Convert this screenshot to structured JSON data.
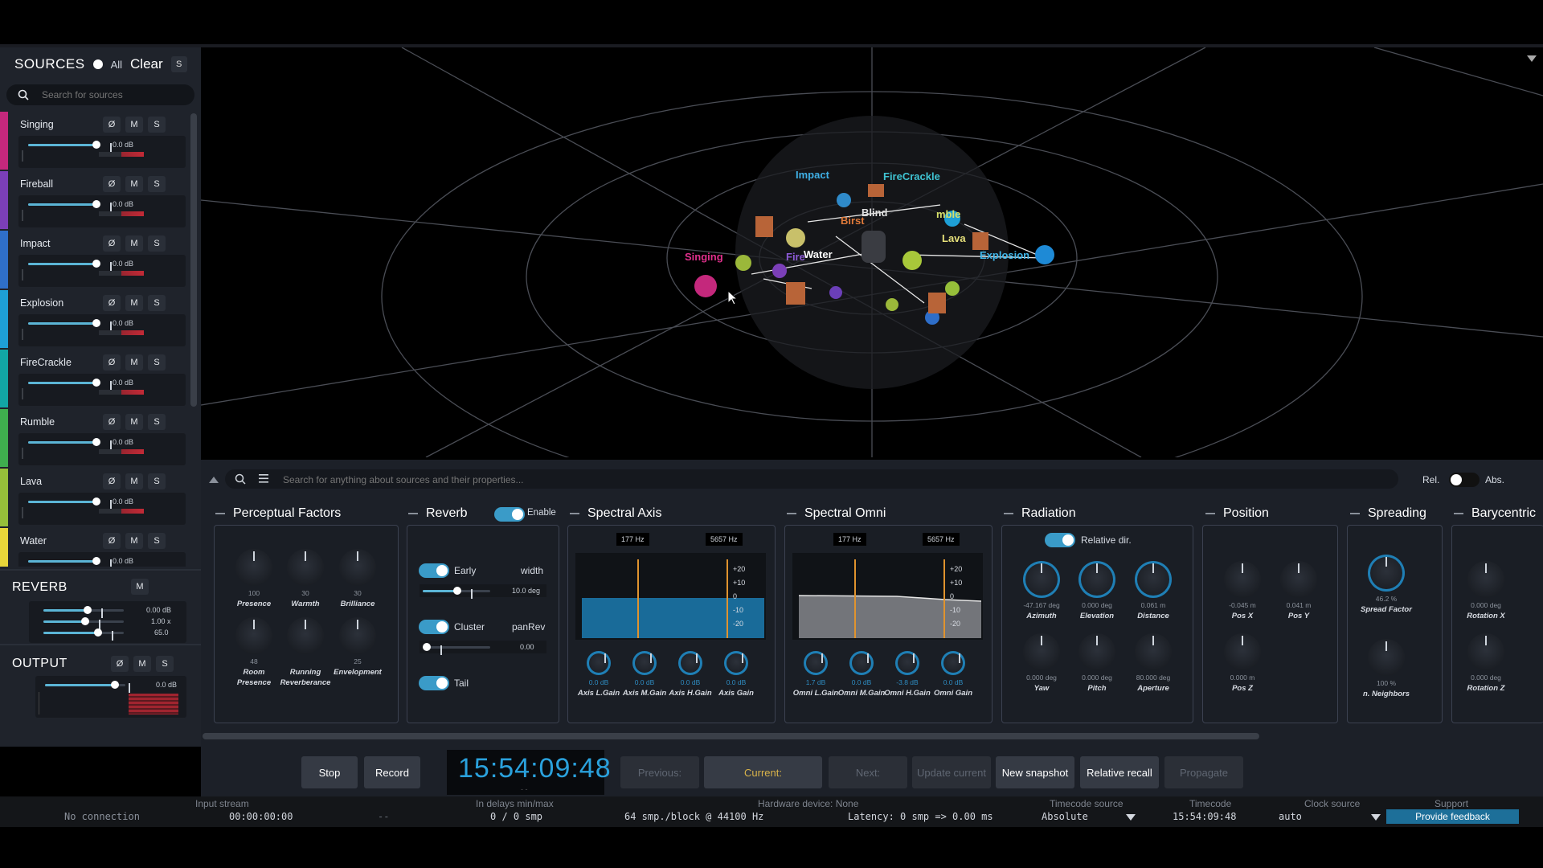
{
  "sidebar": {
    "title": "SOURCES",
    "all_label": "All",
    "clear_label": "Clear",
    "solo_label": "S",
    "search_placeholder": "Search for sources",
    "sources": [
      {
        "name": "Singing",
        "db": "0.0 dB",
        "color": "#c4287c"
      },
      {
        "name": "Fireball",
        "db": "0.0 dB",
        "color": "#7b3fb8"
      },
      {
        "name": "Impact",
        "db": "0.0 dB",
        "color": "#2f6fc9"
      },
      {
        "name": "Explosion",
        "db": "0.0 dB",
        "color": "#1e9fd6"
      },
      {
        "name": "FireCrackle",
        "db": "0.0 dB",
        "color": "#12a6a4"
      },
      {
        "name": "Rumble",
        "db": "0.0 dB",
        "color": "#3fae4e"
      },
      {
        "name": "Lava",
        "db": "0.0 dB",
        "color": "#96bf3a"
      },
      {
        "name": "Water",
        "db": "0.0 dB",
        "color": "#e8d63a"
      }
    ],
    "buttons": {
      "phase": "Ø",
      "mute": "M",
      "solo": "S"
    },
    "reverb": {
      "title": "REVERB",
      "mute": "M",
      "values": [
        "0.00 dB",
        "1.00 x",
        "65.0"
      ]
    },
    "output": {
      "title": "OUTPUT",
      "phase": "Ø",
      "mute": "M",
      "solo": "S",
      "db": "0.0 dB"
    }
  },
  "viewport": {
    "labels": [
      {
        "text": "Impact",
        "color": "#3fb0e6"
      },
      {
        "text": "FireCrackle",
        "color": "#3fc3d2"
      },
      {
        "text": "Singing",
        "color": "#e0308c"
      },
      {
        "text": "Water",
        "color": "#ffffff"
      },
      {
        "text": "Lava",
        "color": "#e6e07a"
      },
      {
        "text": "Explosion",
        "color": "#3fb7ea"
      },
      {
        "text": "Fire",
        "color": "#8c5ad6"
      },
      {
        "text": "Birst",
        "color": "#e07a3a"
      },
      {
        "text": "Blind",
        "color": "#e0e0e0"
      },
      {
        "text": "mble",
        "color": "#d6e06a"
      }
    ]
  },
  "panel": {
    "search_placeholder": "Search for anything about sources and their properties...",
    "rel_label": "Rel.",
    "abs_label": "Abs.",
    "sections": {
      "perceptual": {
        "title": "Perceptual Factors",
        "knobs": [
          {
            "label": "Presence",
            "value": "100"
          },
          {
            "label": "Warmth",
            "value": "30"
          },
          {
            "label": "Brilliance",
            "value": "30"
          },
          {
            "label": "Room Presence",
            "value": "48"
          },
          {
            "label": "Running Reverberance",
            "value": ""
          },
          {
            "label": "Envelopment",
            "value": "25"
          }
        ]
      },
      "reverb": {
        "title": "Reverb",
        "enable_label": "Enable",
        "early_label": "Early",
        "width_label": "width",
        "width_value": "10.0 deg",
        "cluster_label": "Cluster",
        "panrev_label": "panRev",
        "panrev_value": "0.00",
        "tail_label": "Tail"
      },
      "spectral_axis": {
        "title": "Spectral Axis",
        "freq_low": "177 Hz",
        "freq_high": "5657 Hz",
        "scale": [
          "+20",
          "+10",
          "0",
          "-10",
          "-20"
        ],
        "knobs": [
          {
            "label": "Axis L.Gain",
            "value": "0.0 dB"
          },
          {
            "label": "Axis M.Gain",
            "value": "0.0 dB"
          },
          {
            "label": "Axis H.Gain",
            "value": "0.0 dB"
          },
          {
            "label": "Axis Gain",
            "value": "0.0 dB"
          }
        ]
      },
      "spectral_omni": {
        "title": "Spectral Omni",
        "freq_low": "177 Hz",
        "freq_high": "5657 Hz",
        "scale": [
          "+20",
          "+10",
          "0",
          "-10",
          "-20"
        ],
        "knobs": [
          {
            "label": "Omni L.Gain",
            "value": "1.7 dB"
          },
          {
            "label": "Omni M.Gain",
            "value": "0.0 dB"
          },
          {
            "label": "Omni H.Gain",
            "value": "-3.8 dB"
          },
          {
            "label": "Omni Gain",
            "value": "0.0 dB"
          }
        ]
      },
      "radiation": {
        "title": "Radiation",
        "relative_label": "Relative dir.",
        "knobs": [
          {
            "label": "Azimuth",
            "value": "-47.167 deg"
          },
          {
            "label": "Elevation",
            "value": "0.000 deg"
          },
          {
            "label": "Distance",
            "value": "0.061 m"
          },
          {
            "label": "Yaw",
            "value": "0.000 deg"
          },
          {
            "label": "Pitch",
            "value": "0.000 deg"
          },
          {
            "label": "Aperture",
            "value": "80.000 deg"
          }
        ]
      },
      "position": {
        "title": "Position",
        "knobs": [
          {
            "label": "Pos X",
            "value": "-0.045 m"
          },
          {
            "label": "Pos Y",
            "value": "0.041 m"
          },
          {
            "label": "Pos Z",
            "value": "0.000 m"
          }
        ]
      },
      "spreading": {
        "title": "Spreading",
        "knobs": [
          {
            "label": "Spread Factor",
            "value": "46.2 %"
          },
          {
            "label": "n. Neighbors",
            "value": "100 %"
          }
        ]
      },
      "barycentric": {
        "title": "Barycentric",
        "knobs": [
          {
            "label": "Rotation X",
            "value": "0.000 deg"
          },
          {
            "label": "Rotation Z",
            "value": "0.000 deg"
          }
        ]
      }
    }
  },
  "transport": {
    "stop": "Stop",
    "record": "Record",
    "clock": "15:54:09:48",
    "clock_sub": "- -",
    "previous": "Previous:",
    "current": "Current:",
    "next": "Next:",
    "update_current": "Update current",
    "new_snapshot": "New snapshot",
    "relative_recall": "Relative recall",
    "propagate": "Propagate"
  },
  "status": {
    "input_stream_label": "Input stream",
    "no_connection": "No connection",
    "input_time": "00:00:00:00",
    "input_dash": "--",
    "delays_label": "In delays min/max",
    "delays_value": "0 / 0 smp",
    "block": "64 smp./block @ 44100 Hz",
    "hardware_label": "Hardware device: None",
    "latency": "Latency: 0 smp => 0.00 ms",
    "timecode_source_label": "Timecode source",
    "timecode_source_value": "Absolute",
    "timecode_label": "Timecode",
    "timecode_value": "15:54:09:48",
    "clock_source_label": "Clock source",
    "clock_source_value": "auto",
    "support_label": "Support",
    "feedback": "Provide feedback"
  }
}
